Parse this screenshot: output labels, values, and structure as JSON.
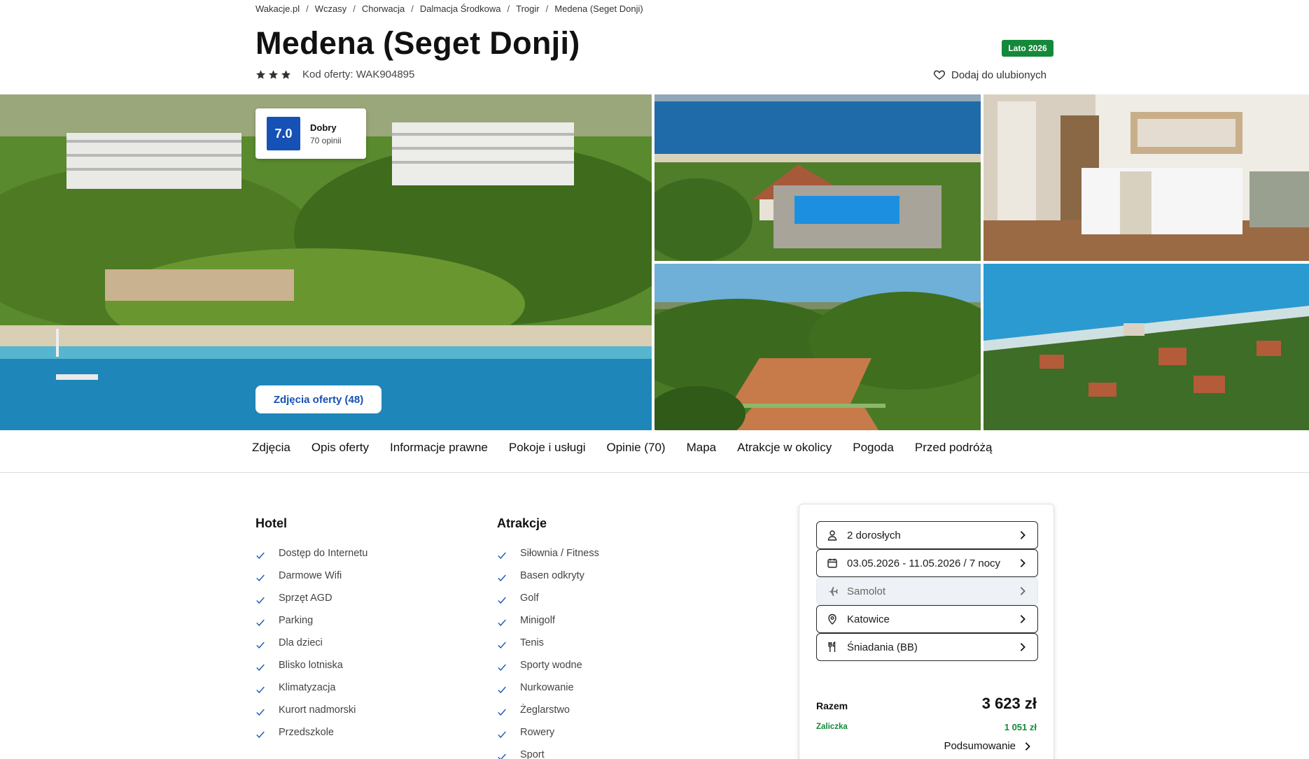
{
  "breadcrumb": [
    "Wakacje.pl",
    "Wczasy",
    "Chorwacja",
    "Dalmacja Środkowa",
    "Trogir",
    "Medena (Seget Donji)"
  ],
  "hotel": {
    "title": "Medena (Seget Donji)",
    "season_badge": "Lato 2026",
    "stars": 3,
    "offer_code": "Kod oferty: WAK904895",
    "favorite_label": "Dodaj do ulubionych"
  },
  "rating": {
    "score": "7.0",
    "label": "Dobry",
    "count": "70 opinii"
  },
  "gallery": {
    "photos_button": "Zdjęcia oferty (48)"
  },
  "tabs": [
    "Zdjęcia",
    "Opis oferty",
    "Informacje prawne",
    "Pokoje i usługi",
    "Opinie (70)",
    "Mapa",
    "Atrakcje w okolicy",
    "Pogoda",
    "Przed podróżą"
  ],
  "amenities": {
    "hotel_title": "Hotel",
    "hotel_items": [
      "Dostęp do Internetu",
      "Darmowe Wifi",
      "Sprzęt AGD",
      "Parking",
      "Dla dzieci",
      "Blisko lotniska",
      "Klimatyzacja",
      "Kurort nadmorski",
      "Przedszkole"
    ],
    "attractions_title": "Atrakcje",
    "attractions_items": [
      "Siłownia / Fitness",
      "Basen odkryty",
      "Golf",
      "Minigolf",
      "Tenis",
      "Sporty wodne",
      "Nurkowanie",
      "Żeglarstwo",
      "Rowery",
      "Sport"
    ]
  },
  "booking": {
    "guests": "2 dorosłych",
    "dates": "03.05.2026 - 11.05.2026 / 7 nocy",
    "transport": "Samolot",
    "departure": "Katowice",
    "board": "Śniadania (BB)",
    "total_label": "Razem",
    "total_value": "3 623 zł",
    "deposit_label": "Zaliczka",
    "deposit_value": "1 051 zł",
    "summary_link": "Podsumowanie"
  },
  "colors": {
    "brand_blue": "#1651b5",
    "badge_green": "#15893a",
    "check_blue": "#1651b5"
  }
}
